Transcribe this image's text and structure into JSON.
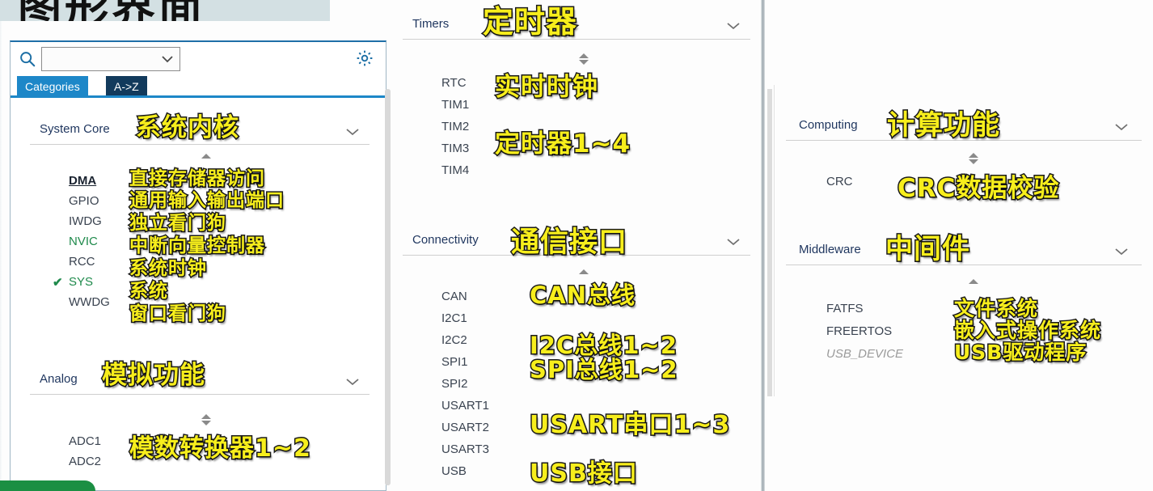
{
  "title_banner": {
    "text": "图形界面"
  },
  "left_panel": {
    "search": {
      "value": "",
      "placeholder": ""
    },
    "icons": {
      "search": "search-icon",
      "gear": "gear-icon",
      "chevron": "chevron-down-icon"
    },
    "tabs": [
      {
        "label": "Categories",
        "selected": true
      },
      {
        "label": "A->Z",
        "selected": false
      }
    ],
    "sections": [
      {
        "name": "System Core",
        "annotation": "系统内核",
        "expanded": true,
        "items": [
          {
            "label": "DMA",
            "state": "hover",
            "annotation": "直接存储器访问"
          },
          {
            "label": "GPIO",
            "state": "normal",
            "annotation": "通用输入输出端口"
          },
          {
            "label": "IWDG",
            "state": "normal",
            "annotation": "独立看门狗"
          },
          {
            "label": "NVIC",
            "state": "green",
            "annotation": "中断向量控制器"
          },
          {
            "label": "RCC",
            "state": "normal",
            "annotation": "系统时钟"
          },
          {
            "label": "SYS",
            "state": "checked",
            "annotation": "系统"
          },
          {
            "label": "WWDG",
            "state": "normal",
            "annotation": "窗口看门狗"
          }
        ]
      },
      {
        "name": "Analog",
        "annotation": "模拟功能",
        "expanded": true,
        "items": [
          {
            "label": "ADC1",
            "state": "normal",
            "annotation": ""
          },
          {
            "label": "ADC2",
            "state": "normal",
            "annotation": ""
          }
        ],
        "group_annotation": "模数转换器1~2"
      }
    ]
  },
  "mid_panel": {
    "sections": [
      {
        "name": "Timers",
        "annotation": "定时器",
        "items": [
          {
            "label": "RTC",
            "state": "normal"
          },
          {
            "label": "TIM1",
            "state": "normal"
          },
          {
            "label": "TIM2",
            "state": "normal"
          },
          {
            "label": "TIM3",
            "state": "normal"
          },
          {
            "label": "TIM4",
            "state": "normal"
          }
        ],
        "annotations": [
          "实时时钟",
          "定时器1~4"
        ]
      },
      {
        "name": "Connectivity",
        "annotation": "通信接口",
        "items": [
          {
            "label": "CAN",
            "state": "normal"
          },
          {
            "label": "I2C1",
            "state": "normal"
          },
          {
            "label": "I2C2",
            "state": "normal"
          },
          {
            "label": "SPI1",
            "state": "normal"
          },
          {
            "label": "SPI2",
            "state": "normal"
          },
          {
            "label": "USART1",
            "state": "normal"
          },
          {
            "label": "USART2",
            "state": "normal"
          },
          {
            "label": "USART3",
            "state": "normal"
          },
          {
            "label": "USB",
            "state": "normal"
          }
        ],
        "annotations": [
          "CAN总线",
          "I2C总线1~2",
          "SPI总线1~2",
          "USART串口1~3",
          "USB接口"
        ]
      }
    ]
  },
  "right_panel": {
    "sections": [
      {
        "name": "Computing",
        "annotation": "计算功能",
        "items": [
          {
            "label": "CRC",
            "state": "normal"
          }
        ],
        "annotations": [
          "CRC数据校验"
        ]
      },
      {
        "name": "Middleware",
        "annotation": "中间件",
        "items": [
          {
            "label": "FATFS",
            "state": "normal"
          },
          {
            "label": "FREERTOS",
            "state": "normal"
          },
          {
            "label": "USB_DEVICE",
            "state": "disabled"
          }
        ],
        "annotations": [
          "文件系统",
          "嵌入式操作系统",
          "USB驱动程序"
        ]
      }
    ]
  },
  "colors": {
    "tab_active": "#1d87c8",
    "tab_inactive": "#123a5c",
    "section_header": "#1e355e",
    "item_enabled_green": "#1f8a4c",
    "annotation_fill": "#f7ee1c",
    "annotation_stroke": "#1a1a1a",
    "green_bar": "#1b8f43",
    "banner_bg": "#d3e0e3"
  }
}
